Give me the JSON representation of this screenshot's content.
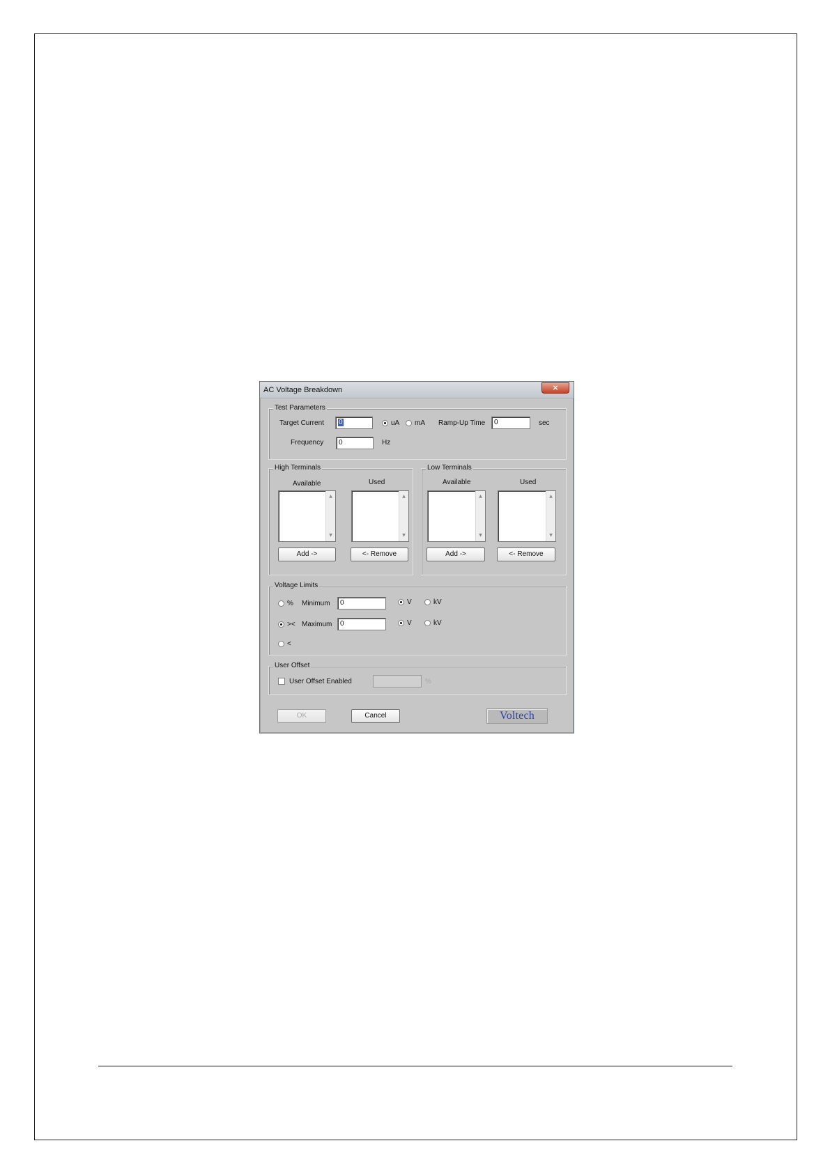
{
  "dialog": {
    "title": "AC Voltage Breakdown",
    "close_glyph": "×",
    "test_parameters": {
      "label": "Test Parameters",
      "target_current_label": "Target Current",
      "target_current_value": "0",
      "unit_ua": "uA",
      "unit_ma": "mA",
      "ramp_up_label": "Ramp-Up Time",
      "ramp_up_value": "0",
      "ramp_up_unit": "sec",
      "frequency_label": "Frequency",
      "frequency_value": "0",
      "frequency_unit": "Hz"
    },
    "high_terminals": {
      "label": "High Terminals",
      "available_label": "Available",
      "used_label": "Used",
      "add_label": "Add ->",
      "remove_label": "<- Remove"
    },
    "low_terminals": {
      "label": "Low Terminals",
      "available_label": "Available",
      "used_label": "Used",
      "add_label": "Add ->",
      "remove_label": "<- Remove"
    },
    "voltage_limits": {
      "label": "Voltage Limits",
      "mode_percent": "%",
      "mode_between": "><",
      "mode_less": "<",
      "minimum_label": "Minimum",
      "minimum_value": "0",
      "maximum_label": "Maximum",
      "maximum_value": "0",
      "unit_v": "V",
      "unit_kv": "kV"
    },
    "user_offset": {
      "label": "User Offset",
      "enabled_label": "User Offset Enabled",
      "offset_unit": "%"
    },
    "buttons": {
      "ok_label": "OK",
      "cancel_label": "Cancel"
    },
    "logo_text": "Voltech"
  }
}
